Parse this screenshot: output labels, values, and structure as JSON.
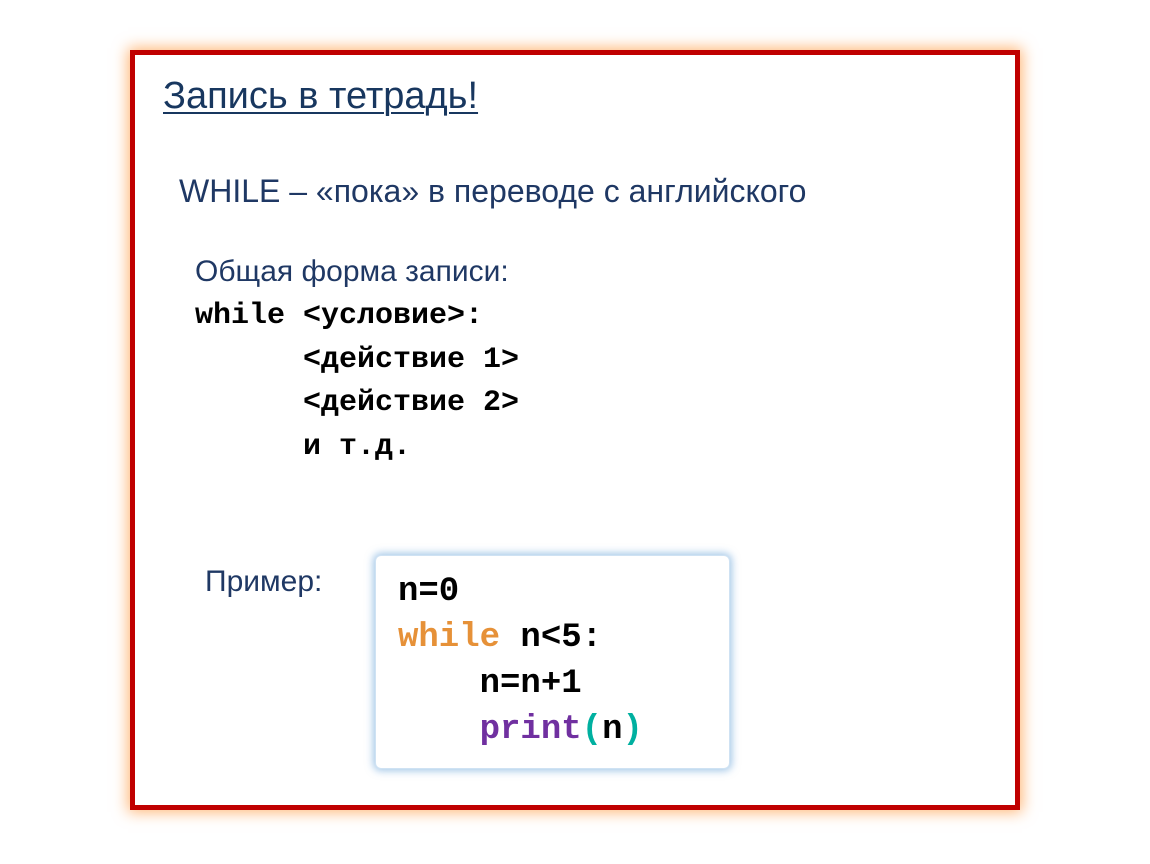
{
  "title": "Запись в тетрадь!",
  "subtitle": "WHILE – «пока» в переводе с английского",
  "section_label": "Общая форма записи:",
  "syntax": {
    "line1": "while <условие>:",
    "line2": "      <действие 1>",
    "line3": "      <действие 2>",
    "line4": "      и т.д."
  },
  "example_label": "Пример:",
  "code": {
    "line1_a": "n=0",
    "line2_kw": "while",
    "line2_rest": " n<5:",
    "line3": "    n=n+1",
    "line4_indent": "    ",
    "line4_fn": "print",
    "line4_paren_open": "(",
    "line4_arg": "n",
    "line4_paren_close": ")"
  }
}
